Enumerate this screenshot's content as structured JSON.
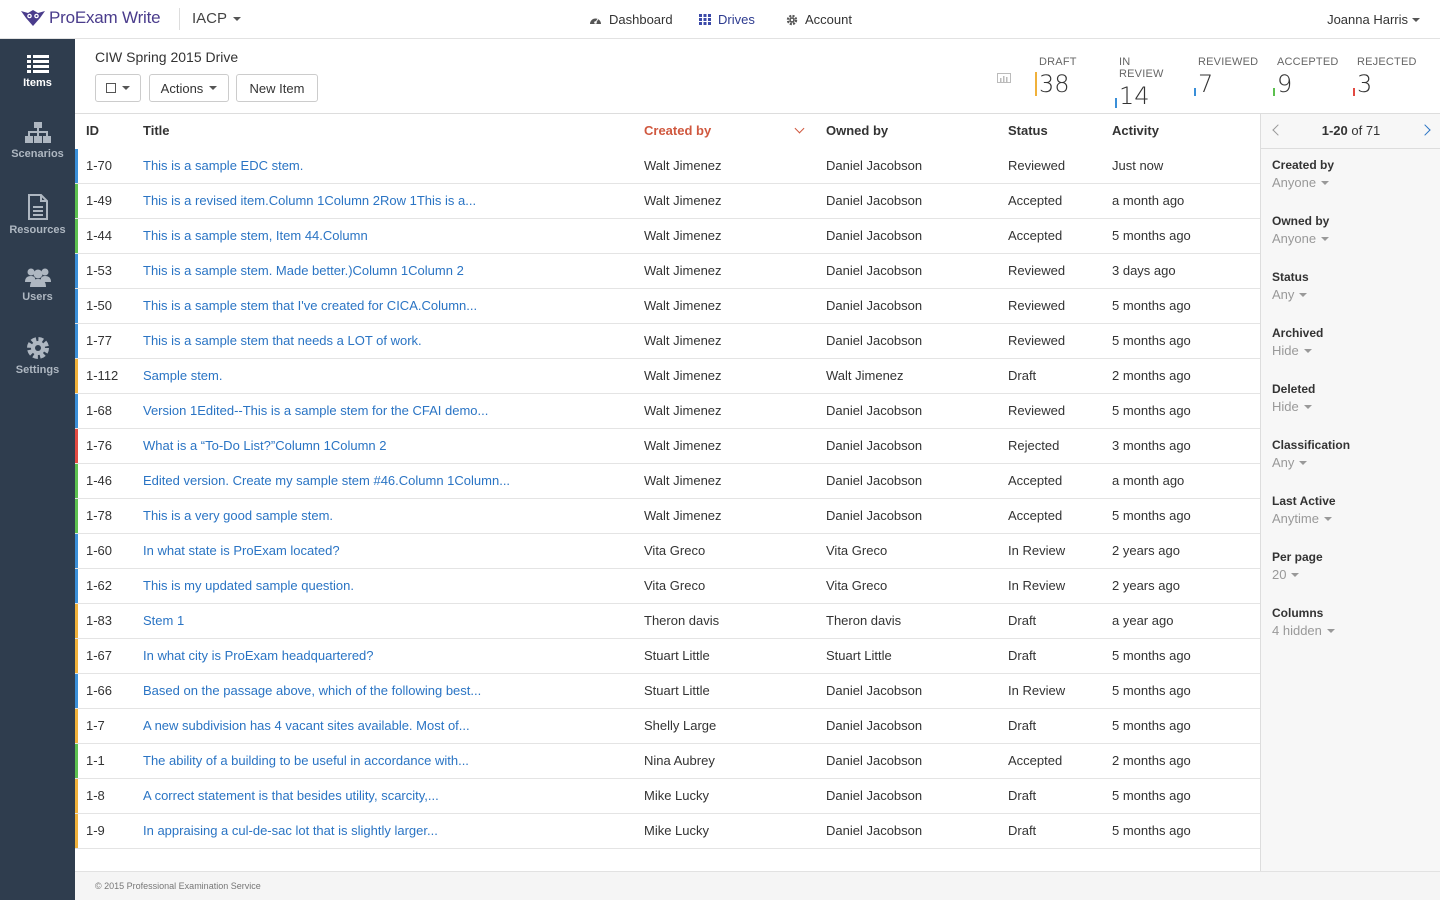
{
  "app": {
    "name_pro": "ProExam",
    "name_write": "Write",
    "org": "IACP"
  },
  "nav": {
    "dashboard": "Dashboard",
    "drives": "Drives",
    "account": "Account"
  },
  "user": {
    "name": "Joanna Harris"
  },
  "sidebar": {
    "items": [
      {
        "label": "Items"
      },
      {
        "label": "Scenarios"
      },
      {
        "label": "Resources"
      },
      {
        "label": "Users"
      },
      {
        "label": "Settings"
      }
    ]
  },
  "drive": {
    "title": "CIW Spring 2015 Drive",
    "actions_label": "Actions",
    "new_item_label": "New Item"
  },
  "stats": [
    {
      "label": "DRAFT",
      "value": "38",
      "color": "#f0b13b"
    },
    {
      "label": "IN REVIEW",
      "value": "14",
      "color": "#3a8fd8"
    },
    {
      "label": "REVIEWED",
      "value": "7",
      "color": "#3a8fd8"
    },
    {
      "label": "ACCEPTED",
      "value": "9",
      "color": "#5cc04f"
    },
    {
      "label": "REJECTED",
      "value": "3",
      "color": "#e24a42"
    }
  ],
  "table": {
    "headers": {
      "id": "ID",
      "title": "Title",
      "created_by": "Created by",
      "owned_by": "Owned by",
      "status": "Status",
      "activity": "Activity"
    },
    "rows": [
      {
        "id": "1-70",
        "title": "This is a sample EDC stem.",
        "created_by": "Walt Jimenez",
        "owned_by": "Daniel Jacobson",
        "status": "Reviewed",
        "activity": "Just now",
        "color": "#3a8fd8"
      },
      {
        "id": "1-49",
        "title": "This is a revised item.Column 1Column 2Row 1This is a...",
        "created_by": "Walt Jimenez",
        "owned_by": "Daniel Jacobson",
        "status": "Accepted",
        "activity": "a month ago",
        "color": "#5cc04f"
      },
      {
        "id": "1-44",
        "title": "This is a sample stem, Item 44.Column",
        "created_by": "Walt Jimenez",
        "owned_by": "Daniel Jacobson",
        "status": "Accepted",
        "activity": "5 months ago",
        "color": "#5cc04f"
      },
      {
        "id": "1-53",
        "title": "This is a sample stem. Made better.)Column 1Column 2",
        "created_by": "Walt Jimenez",
        "owned_by": "Daniel Jacobson",
        "status": "Reviewed",
        "activity": "3 days ago",
        "color": "#3a8fd8"
      },
      {
        "id": "1-50",
        "title": "This is a sample stem that I've created for CICA.Column...",
        "created_by": "Walt Jimenez",
        "owned_by": "Daniel Jacobson",
        "status": "Reviewed",
        "activity": "5 months ago",
        "color": "#3a8fd8"
      },
      {
        "id": "1-77",
        "title": "This is a sample stem that needs a LOT of work.",
        "created_by": "Walt Jimenez",
        "owned_by": "Daniel Jacobson",
        "status": "Reviewed",
        "activity": "5 months ago",
        "color": "#3a8fd8"
      },
      {
        "id": "1-112",
        "title": "Sample stem.",
        "created_by": "Walt Jimenez",
        "owned_by": "Walt Jimenez",
        "status": "Draft",
        "activity": "2 months ago",
        "color": "#f0b13b"
      },
      {
        "id": "1-68",
        "title": "Version 1Edited--This is a sample stem for the CFAI demo...",
        "created_by": "Walt Jimenez",
        "owned_by": "Daniel Jacobson",
        "status": "Reviewed",
        "activity": "5 months ago",
        "color": "#3a8fd8"
      },
      {
        "id": "1-76",
        "title": "What is a “To-Do List?”Column 1Column 2",
        "created_by": "Walt Jimenez",
        "owned_by": "Daniel Jacobson",
        "status": "Rejected",
        "activity": "3 months ago",
        "color": "#e24a42"
      },
      {
        "id": "1-46",
        "title": "Edited version. Create my sample stem #46.Column 1Column...",
        "created_by": "Walt Jimenez",
        "owned_by": "Daniel Jacobson",
        "status": "Accepted",
        "activity": "a month ago",
        "color": "#5cc04f"
      },
      {
        "id": "1-78",
        "title": "This is a very good sample stem.",
        "created_by": "Walt Jimenez",
        "owned_by": "Daniel Jacobson",
        "status": "Accepted",
        "activity": "5 months ago",
        "color": "#5cc04f"
      },
      {
        "id": "1-60",
        "title": "In what state is ProExam located?",
        "created_by": "Vita Greco",
        "owned_by": "Vita Greco",
        "status": "In Review",
        "activity": "2 years ago",
        "color": "#3a8fd8"
      },
      {
        "id": "1-62",
        "title": "This is my updated sample question.",
        "created_by": "Vita Greco",
        "owned_by": "Vita Greco",
        "status": "In Review",
        "activity": "2 years ago",
        "color": "#3a8fd8"
      },
      {
        "id": "1-83",
        "title": "Stem 1",
        "created_by": "Theron davis",
        "owned_by": "Theron davis",
        "status": "Draft",
        "activity": "a year ago",
        "color": "#f0b13b"
      },
      {
        "id": "1-67",
        "title": "In what city is ProExam headquartered?",
        "created_by": "Stuart Little",
        "owned_by": "Stuart Little",
        "status": "Draft",
        "activity": "5 months ago",
        "color": "#f0b13b"
      },
      {
        "id": "1-66",
        "title": "Based on the passage above, which of the following best...",
        "created_by": "Stuart Little",
        "owned_by": "Daniel Jacobson",
        "status": "In Review",
        "activity": "5 months ago",
        "color": "#3a8fd8"
      },
      {
        "id": "1-7",
        "title": "A new subdivision has 4 vacant sites available. Most of...",
        "created_by": "Shelly Large",
        "owned_by": "Daniel Jacobson",
        "status": "Draft",
        "activity": "5 months ago",
        "color": "#f0b13b"
      },
      {
        "id": "1-1",
        "title": "The ability of a building to be useful in accordance with...",
        "created_by": "Nina Aubrey",
        "owned_by": "Daniel Jacobson",
        "status": "Accepted",
        "activity": "2 months ago",
        "color": "#5cc04f"
      },
      {
        "id": "1-8",
        "title": "A correct statement is that besides utility, scarcity,...",
        "created_by": "Mike Lucky",
        "owned_by": "Daniel Jacobson",
        "status": "Draft",
        "activity": "5 months ago",
        "color": "#f0b13b"
      },
      {
        "id": "1-9",
        "title": "In appraising a cul-de-sac lot that is slightly larger...",
        "created_by": "Mike Lucky",
        "owned_by": "Daniel Jacobson",
        "status": "Draft",
        "activity": "5 months ago",
        "color": "#f0b13b"
      }
    ]
  },
  "pager": {
    "range": "1-20",
    "of_total": " of 71"
  },
  "filters": [
    {
      "label": "Created by",
      "value": "Anyone"
    },
    {
      "label": "Owned by",
      "value": "Anyone"
    },
    {
      "label": "Status",
      "value": "Any"
    },
    {
      "label": "Archived",
      "value": "Hide"
    },
    {
      "label": "Deleted",
      "value": "Hide"
    },
    {
      "label": "Classification",
      "value": "Any"
    },
    {
      "label": "Last Active",
      "value": "Anytime"
    },
    {
      "label": "Per page",
      "value": "20"
    },
    {
      "label": "Columns",
      "value": "4 hidden"
    }
  ],
  "footer": {
    "copyright": "© 2015 Professional Examination Service"
  }
}
